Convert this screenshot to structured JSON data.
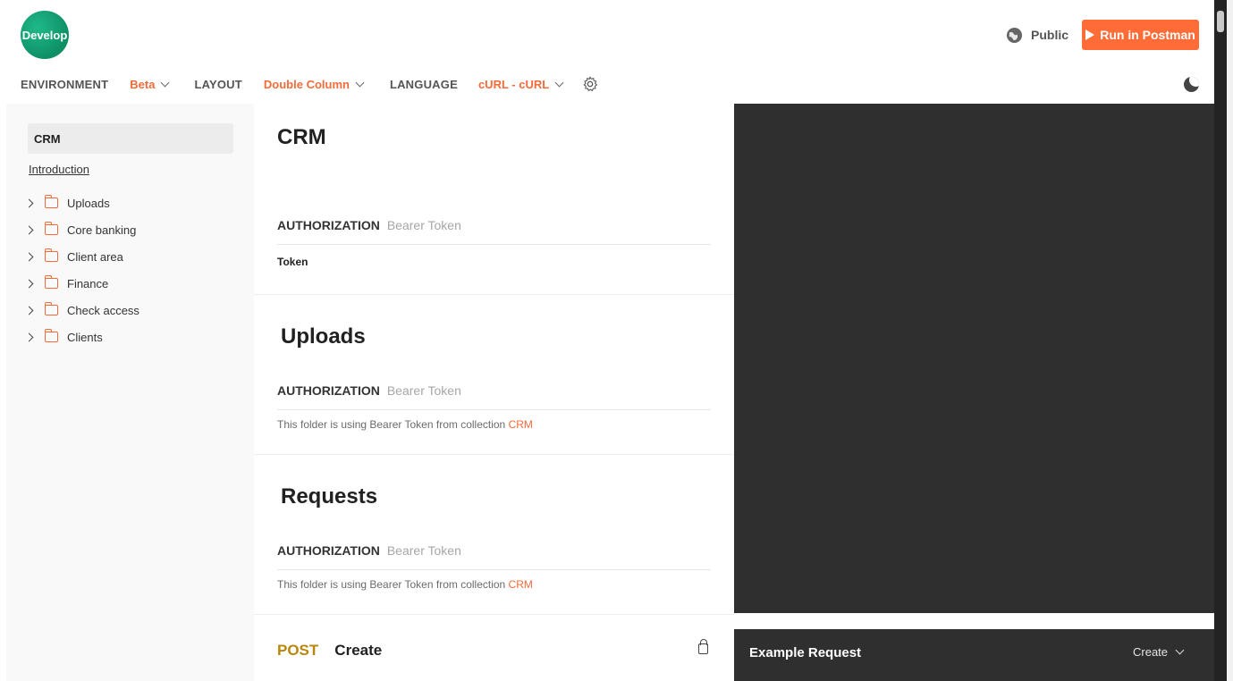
{
  "header": {
    "logo_text": "Develop",
    "visibility": "Public",
    "run_button": "Run in Postman"
  },
  "toolbar": {
    "environment_label": "ENVIRONMENT",
    "environment_value": "Beta",
    "layout_label": "LAYOUT",
    "layout_value": "Double Column",
    "language_label": "LANGUAGE",
    "language_value": "cURL - cURL"
  },
  "sidebar": {
    "collection": "CRM",
    "intro": "Introduction",
    "folders": [
      "Uploads",
      "Core banking",
      "Client area",
      "Finance",
      "Check access",
      "Clients"
    ]
  },
  "main": {
    "crm": {
      "title": "CRM",
      "auth_key": "AUTHORIZATION",
      "auth_value": "Bearer Token",
      "token_label": "Token"
    },
    "uploads": {
      "title": "Uploads",
      "auth_key": "AUTHORIZATION",
      "auth_value": "Bearer Token",
      "note": "This folder is using Bearer Token from collection",
      "note_link": "CRM"
    },
    "requests": {
      "title": "Requests",
      "auth_key": "AUTHORIZATION",
      "auth_value": "Bearer Token",
      "note": "This folder is using Bearer Token from collection",
      "note_link": "CRM"
    },
    "post": {
      "method": "POST",
      "name": "Create"
    }
  },
  "example": {
    "title": "Example Request",
    "selected": "Create"
  },
  "colors": {
    "accent": "#f26b3a",
    "run_button": "#ff6c37",
    "dark_panel": "#2f2f2f",
    "post_method": "#b8860b"
  }
}
